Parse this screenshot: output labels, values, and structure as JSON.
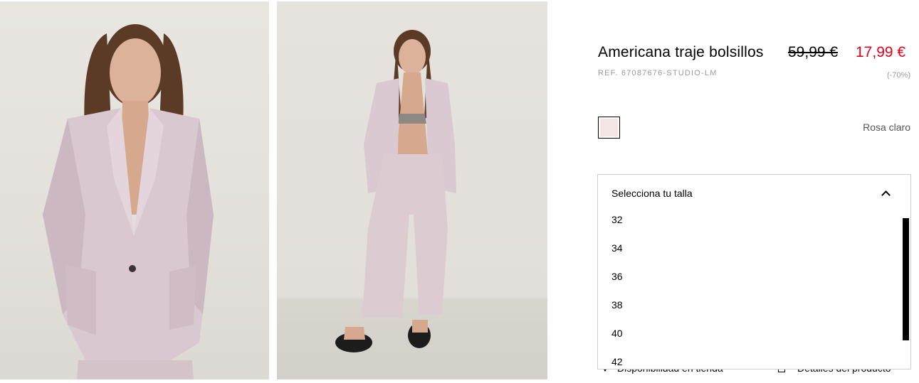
{
  "product": {
    "title": "Americana traje bolsillos",
    "old_price": "59,99 €",
    "new_price": "17,99 €",
    "reference": "REF. 67087676-STUDIO-LM",
    "discount": "(-70%)"
  },
  "color": {
    "name": "Rosa claro",
    "swatch_hex": "#f5e6e6"
  },
  "size_selector": {
    "placeholder": "Selecciona tu talla",
    "options": [
      "32",
      "34",
      "36",
      "38",
      "40",
      "42"
    ]
  },
  "links": {
    "store_availability": "Disponibilidad en tienda",
    "product_details": "Detalles del producto"
  },
  "photos": [
    {
      "icon": "product-photo-front-closeup"
    },
    {
      "icon": "product-photo-full-body"
    }
  ],
  "colors": {
    "sale_red": "#e4001b",
    "muted_gray": "#9a9a9a"
  }
}
